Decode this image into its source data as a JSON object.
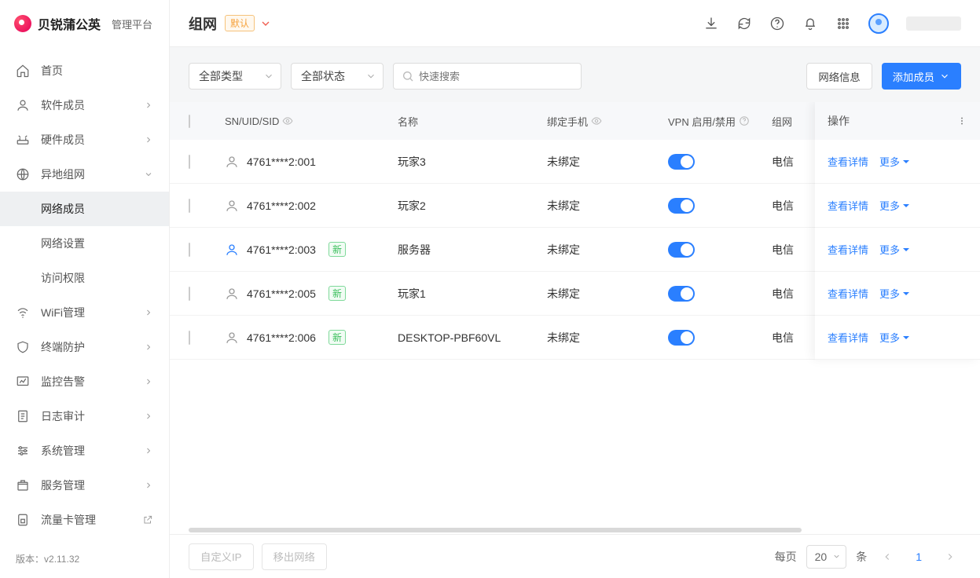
{
  "brand": {
    "name": "贝锐蒲公英",
    "suffix": "管理平台"
  },
  "sidebar": {
    "items": [
      {
        "label": "首页"
      },
      {
        "label": "软件成员"
      },
      {
        "label": "硬件成员"
      },
      {
        "label": "异地组网"
      },
      {
        "label": "WiFi管理"
      },
      {
        "label": "终端防护"
      },
      {
        "label": "监控告警"
      },
      {
        "label": "日志审计"
      },
      {
        "label": "系统管理"
      },
      {
        "label": "服务管理"
      },
      {
        "label": "流量卡管理"
      }
    ],
    "sub": {
      "members": "网络成员",
      "settings": "网络设置",
      "access": "访问权限"
    },
    "version_label": "版本：",
    "version": "v2.11.32"
  },
  "header": {
    "title": "组网",
    "default_badge": "默认"
  },
  "toolbar": {
    "type_filter": "全部类型",
    "status_filter": "全部状态",
    "search_placeholder": "快速搜索",
    "network_info": "网络信息",
    "add_member": "添加成员"
  },
  "table": {
    "headers": {
      "sn": "SN/UID/SID",
      "name": "名称",
      "phone": "绑定手机",
      "vpn": "VPN 启用/禁用",
      "network": "组网",
      "actions": "操作"
    },
    "new_badge": "新",
    "rows": [
      {
        "sn": "4761****2:001",
        "name": "玩家3",
        "phone": "未绑定",
        "vpn": true,
        "net": "电信",
        "new": false,
        "online": false
      },
      {
        "sn": "4761****2:002",
        "name": "玩家2",
        "phone": "未绑定",
        "vpn": true,
        "net": "电信",
        "new": false,
        "online": false
      },
      {
        "sn": "4761****2:003",
        "name": "服务器",
        "phone": "未绑定",
        "vpn": true,
        "net": "电信",
        "new": true,
        "online": true
      },
      {
        "sn": "4761****2:005",
        "name": "玩家1",
        "phone": "未绑定",
        "vpn": true,
        "net": "电信",
        "new": true,
        "online": false
      },
      {
        "sn": "4761****2:006",
        "name": "DESKTOP-PBF60VL",
        "phone": "未绑定",
        "vpn": true,
        "net": "电信",
        "new": true,
        "online": false
      }
    ],
    "actions": {
      "detail": "查看详情",
      "more": "更多"
    }
  },
  "footer": {
    "custom_ip": "自定义IP",
    "remove": "移出网络",
    "per_page_label": "每页",
    "per_page_value": "20",
    "per_page_unit": "条",
    "current_page": "1"
  }
}
